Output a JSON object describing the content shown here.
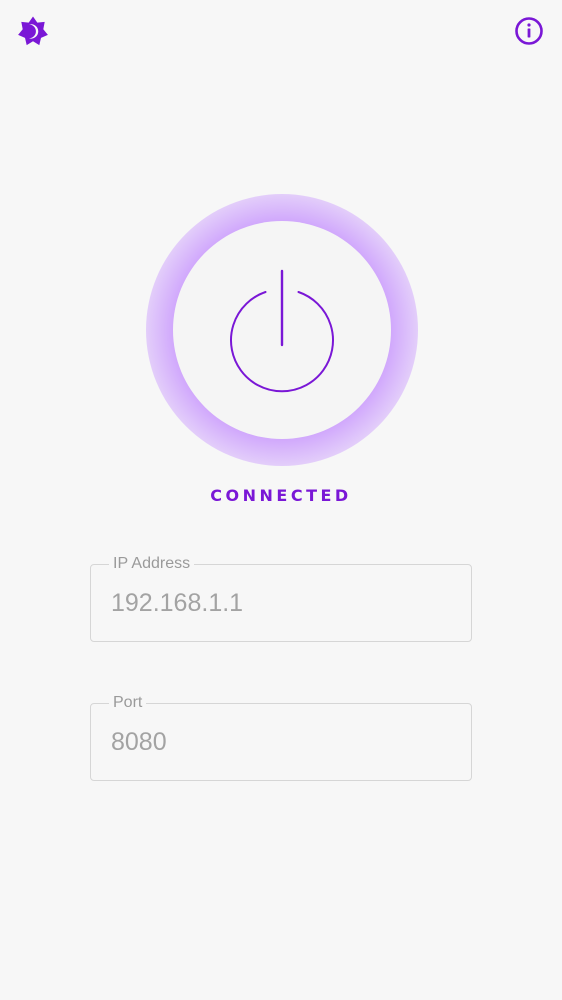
{
  "header": {
    "theme_icon": "brightness-icon",
    "info_icon": "info-icon"
  },
  "power": {
    "icon": "power-icon",
    "status": "CONNECTED"
  },
  "form": {
    "ip": {
      "label": "IP Address",
      "value": "192.168.1.1"
    },
    "port": {
      "label": "Port",
      "value": "8080"
    }
  },
  "colors": {
    "accent": "#7a17d6",
    "glow": "#b064ff",
    "background": "#f7f7f7",
    "field_border": "#d6d6d6",
    "muted_text": "#a3a3a3"
  }
}
